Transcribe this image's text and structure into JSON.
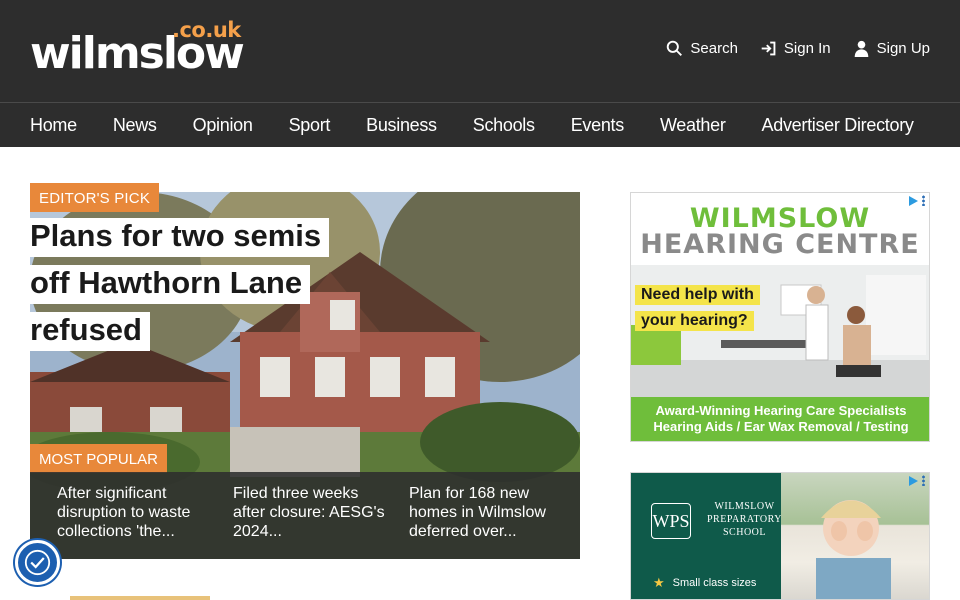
{
  "header": {
    "logo_text": "wilmslow",
    "logo_tld": ".co.uk",
    "actions": [
      {
        "label": "Search",
        "icon": "search-icon"
      },
      {
        "label": "Sign In",
        "icon": "sign-in-icon"
      },
      {
        "label": "Sign Up",
        "icon": "user-icon"
      }
    ]
  },
  "nav": {
    "items": [
      "Home",
      "News",
      "Opinion",
      "Sport",
      "Business",
      "Schools",
      "Events",
      "Weather",
      "Advertiser Directory"
    ]
  },
  "featured": {
    "badge": "EDITOR'S PICK",
    "headline": "Plans for two semis off Hawthorn Lane refused"
  },
  "most_popular": {
    "badge": "MOST POPULAR",
    "items": [
      "After significant disruption to waste collections 'the...",
      "Filed three weeks after closure: AESG's 2024...",
      "Plan for 168 new homes in Wilmslow deferred over..."
    ]
  },
  "ads": {
    "hearing": {
      "title_line1": "WILMSLOW",
      "title_line2": "HEARING CENTRE",
      "help_line1": "Need help with",
      "help_line2": "your hearing?",
      "footer_line1": "Award-Winning Hearing Care Specialists",
      "footer_line2": "Hearing Aids / Ear Wax Removal / Testing"
    },
    "school": {
      "crest": "WPS",
      "name_line1": "WILMSLOW",
      "name_line2": "PREPARATORY",
      "name_line3": "SCHOOL",
      "bullet": "Small class sizes"
    }
  },
  "colors": {
    "header_bg": "#2d2d2d",
    "accent": "#e8883a",
    "ad_green": "#6fbe3b",
    "school_green": "#0f5a4a"
  }
}
